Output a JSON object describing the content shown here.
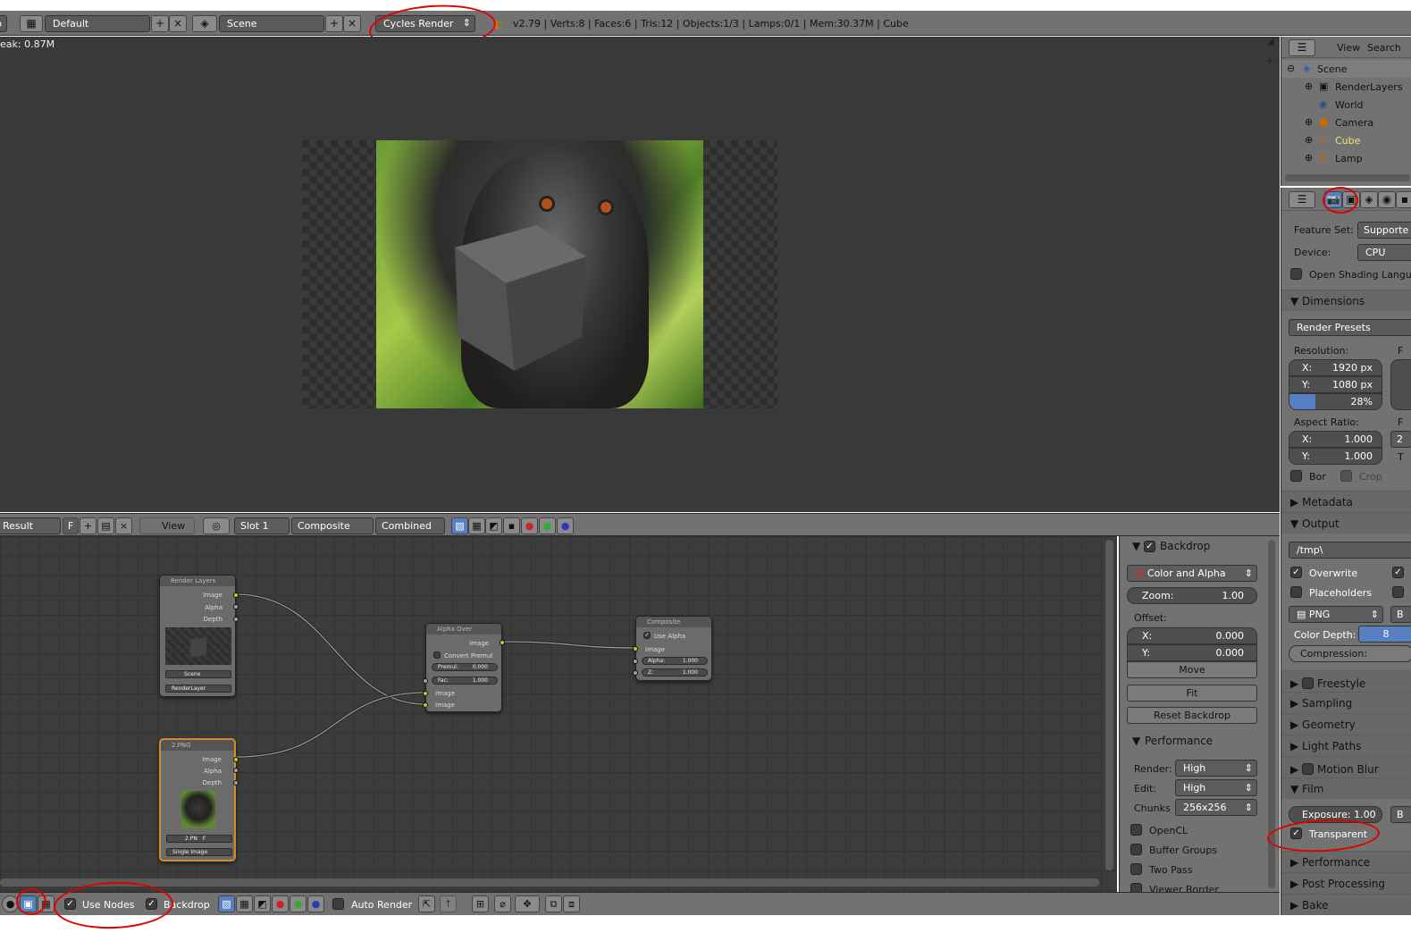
{
  "topbar": {
    "layout_value": "Default",
    "scene_value": "Scene",
    "engine_value": "Cycles Render",
    "stats": "v2.79 | Verts:8 | Faces:6 | Tris:12 | Objects:1/3 | Lamps:0/1 | Mem:30.37M | Cube"
  },
  "viewport": {
    "peak": "eak: 0.87M"
  },
  "image_header": {
    "result": "Result",
    "f_label": "F",
    "view": "View",
    "slot": "Slot 1",
    "layer": "Composite",
    "pass": "Combined"
  },
  "nodes": {
    "render_layers": {
      "title": "Render Layers",
      "out1": "Image",
      "out2": "Alpha",
      "out3": "Depth",
      "scene": "Scene",
      "layer": "RenderLayer"
    },
    "png": {
      "title": "2.PNG",
      "out1": "Image",
      "out2": "Alpha",
      "out3": "Depth",
      "name": "2.PN",
      "f": "F",
      "source": "Single Image"
    },
    "alpha_over": {
      "title": "Alpha Over",
      "out": "Image",
      "convert": "Convert Premul",
      "premul_label": "Premul:",
      "premul_value": "0.000",
      "fac_label": "Fac:",
      "fac_value": "1.000",
      "in1": "Image",
      "in2": "Image"
    },
    "composite": {
      "title": "Composite",
      "use_alpha": "Use Alpha",
      "in": "Image",
      "alpha_label": "Alpha:",
      "alpha_value": "1.000",
      "z_label": "Z:",
      "z_value": "1.000"
    }
  },
  "node_panel": {
    "backdrop_header": "Backdrop",
    "color_mode": "Color and Alpha",
    "zoom_label": "Zoom:",
    "zoom_value": "1.00",
    "offset_label": "Offset:",
    "x_label": "X:",
    "x_value": "0.000",
    "y_label": "Y:",
    "y_value": "0.000",
    "move": "Move",
    "fit": "Fit",
    "reset": "Reset Backdrop",
    "performance_header": "Performance",
    "render_label": "Render:",
    "render_value": "High",
    "edit_label": "Edit:",
    "edit_value": "High",
    "chunks_label": "Chunks",
    "chunks_value": "256x256",
    "opencl": "OpenCL",
    "buffer_groups": "Buffer Groups",
    "two_pass": "Two Pass",
    "viewer_border": "Viewer Border"
  },
  "outliner": {
    "view": "View",
    "search": "Search",
    "items": [
      "Scene",
      "RenderLayers",
      "World",
      "Camera",
      "Cube",
      "Lamp"
    ]
  },
  "properties": {
    "feature_set_label": "Feature Set:",
    "feature_set_value": "Supporte",
    "device_label": "Device:",
    "device_value": "CPU",
    "osl": "Open Shading Langua",
    "dimensions": "Dimensions",
    "render_presets": "Render Presets",
    "resolution_label": "Resolution:",
    "res_x_label": "X:",
    "res_x_value": "1920 px",
    "res_y_label": "Y:",
    "res_y_value": "1080 px",
    "res_pct": "28%",
    "aspect_label": "Aspect Ratio:",
    "asp_x_label": "X:",
    "asp_x_value": "1.000",
    "asp_y_label": "Y:",
    "asp_y_value": "1.000",
    "border": "Bor",
    "crop": "Crop",
    "metadata": "Metadata",
    "output": "Output",
    "output_path": "/tmp\\",
    "overwrite": "Overwrite",
    "placeholders": "Placeholders",
    "format": "PNG",
    "color_depth_label": "Color Depth:",
    "color_depth_value": "8",
    "compression": "Compression:",
    "freestyle": "Freestyle",
    "sampling": "Sampling",
    "geometry": "Geometry",
    "light_paths": "Light Paths",
    "motion_blur": "Motion Blur",
    "film": "Film",
    "exposure": "Exposure: 1.00",
    "transparent": "Transparent",
    "performance": "Performance",
    "post_processing": "Post Processing",
    "bake": "Bake",
    "cut_f": "F",
    "cut_b": "B",
    "cut_2": "2",
    "cut_t": "T"
  },
  "footer": {
    "use_nodes": "Use Nodes",
    "backdrop": "Backdrop",
    "auto_render": "Auto Render"
  },
  "colors": {
    "panel_gray": "#727272",
    "viewport_bg": "#393939",
    "accent_blue": "#5680c2",
    "annotation_red": "#e00000"
  }
}
